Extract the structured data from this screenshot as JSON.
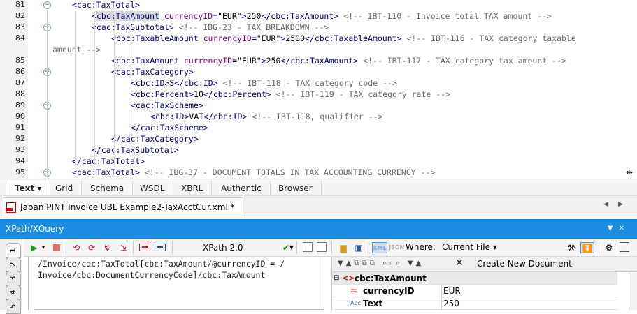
{
  "editor": {
    "lines": [
      {
        "num": "81",
        "indent": 2,
        "fold": "−",
        "parts": [
          [
            "tg",
            "<cac:TaxTotal>"
          ]
        ]
      },
      {
        "num": "82",
        "indent": 3,
        "fold": "",
        "parts": [
          [
            "tg",
            "<"
          ],
          [
            "hl",
            "cbc:TaxAmount"
          ],
          [
            "tg",
            " "
          ],
          [
            "at",
            "currencyID"
          ],
          [
            "tg",
            "="
          ],
          [
            "av",
            "\"EUR\""
          ],
          [
            "tg",
            ">"
          ],
          [
            "tx",
            "250"
          ],
          [
            "tg",
            "</cbc:TaxAmount>"
          ],
          [
            "tx",
            " "
          ],
          [
            "cm",
            "<!-- IBT-110 - Invoice total TAX amount -->"
          ]
        ]
      },
      {
        "num": "83",
        "indent": 3,
        "fold": "−",
        "parts": [
          [
            "tg",
            "<cac:TaxSubtotal>"
          ],
          [
            "tx",
            " "
          ],
          [
            "cm",
            "<!-- IBG-23 - TAX BREAKDOWN -->"
          ]
        ]
      },
      {
        "num": "84",
        "indent": 4,
        "fold": "",
        "parts": [
          [
            "tg",
            "<cbc:TaxableAmount "
          ],
          [
            "at",
            "currencyID"
          ],
          [
            "tg",
            "="
          ],
          [
            "av",
            "\"EUR\""
          ],
          [
            "tg",
            ">"
          ],
          [
            "tx",
            "2500"
          ],
          [
            "tg",
            "</cbc:TaxableAmount>"
          ],
          [
            "tx",
            " "
          ],
          [
            "cm",
            "<!-- IBT-116 - TAX category taxable"
          ]
        ]
      },
      {
        "num": "",
        "indent": 0,
        "fold": "",
        "wrap": true,
        "parts": [
          [
            "cm",
            "amount -->"
          ]
        ]
      },
      {
        "num": "85",
        "indent": 4,
        "fold": "",
        "parts": [
          [
            "tg",
            "<cbc:TaxAmount "
          ],
          [
            "at",
            "currencyID"
          ],
          [
            "tg",
            "="
          ],
          [
            "av",
            "\"EUR\""
          ],
          [
            "tg",
            ">"
          ],
          [
            "tx",
            "250"
          ],
          [
            "tg",
            "</cbc:TaxAmount>"
          ],
          [
            "tx",
            " "
          ],
          [
            "cm",
            "<!-- IBT-117 - TAX category tax amount -->"
          ]
        ]
      },
      {
        "num": "86",
        "indent": 4,
        "fold": "−",
        "parts": [
          [
            "tg",
            "<cac:TaxCategory>"
          ]
        ]
      },
      {
        "num": "87",
        "indent": 5,
        "fold": "",
        "parts": [
          [
            "tg",
            "<cbc:ID>"
          ],
          [
            "tx",
            "S"
          ],
          [
            "tg",
            "</cbc:ID>"
          ],
          [
            "tx",
            " "
          ],
          [
            "cm",
            "<!-- IBT-118 - TAX category code -->"
          ]
        ]
      },
      {
        "num": "88",
        "indent": 5,
        "fold": "",
        "parts": [
          [
            "tg",
            "<cbc:Percent>"
          ],
          [
            "tx",
            "10"
          ],
          [
            "tg",
            "</cbc:Percent>"
          ],
          [
            "tx",
            " "
          ],
          [
            "cm",
            "<!-- IBT-119 - TAX category rate -->"
          ]
        ]
      },
      {
        "num": "89",
        "indent": 5,
        "fold": "−",
        "parts": [
          [
            "tg",
            "<cac:TaxScheme>"
          ]
        ]
      },
      {
        "num": "90",
        "indent": 6,
        "fold": "",
        "parts": [
          [
            "tg",
            "<cbc:ID>"
          ],
          [
            "tx",
            "VAT"
          ],
          [
            "tg",
            "</cbc:ID>"
          ],
          [
            "tx",
            " "
          ],
          [
            "cm",
            "<!-- IBT-118, qualifier -->"
          ]
        ]
      },
      {
        "num": "91",
        "indent": 5,
        "fold": "",
        "parts": [
          [
            "tg",
            "</cac:TaxScheme>"
          ]
        ]
      },
      {
        "num": "92",
        "indent": 4,
        "fold": "",
        "parts": [
          [
            "tg",
            "</cac:TaxCategory>"
          ]
        ]
      },
      {
        "num": "93",
        "indent": 3,
        "fold": "",
        "parts": [
          [
            "tg",
            "</cac:TaxSubtotal>"
          ]
        ]
      },
      {
        "num": "94",
        "indent": 2,
        "fold": "",
        "parts": [
          [
            "tg",
            "</cac:TaxTotal>"
          ]
        ]
      },
      {
        "num": "95",
        "indent": 2,
        "fold": "−",
        "parts": [
          [
            "tg",
            "<cac:TaxTotal>"
          ],
          [
            "tx",
            " "
          ],
          [
            "cm",
            "<!-- IBG-37 - DOCUMENT TOTALS IN TAX ACCOUNTING CURRENCY -->"
          ]
        ]
      }
    ]
  },
  "view_tabs": [
    "Text ▾",
    "Grid",
    "Schema",
    "WSDL",
    "XBRL",
    "Authentic",
    "Browser"
  ],
  "document_tab": {
    "label": "Japan PINT Invoice UBL Example2-TaxAcctCur.xml *"
  },
  "xpath_panel": {
    "title": "XPath/XQuery",
    "version_combo": "XPath 2.0",
    "json_label": "JSON",
    "xml_label": "XML",
    "where_label": "Where:",
    "where_value": "Current File ▾",
    "tabs": [
      "1",
      "2",
      "3",
      "4",
      "5",
      "6"
    ],
    "expression_lines": [
      "/Invoice/cac:TaxTotal[cbc:TaxAmount/@currencyID = /",
      "Invoice/cbc:DocumentCurrencyCode]/cbc:TaxAmount"
    ],
    "results": {
      "create_label": "Create New Document",
      "rows": [
        {
          "icon": "<>",
          "name": "cbc:TaxAmount",
          "value": ""
        },
        {
          "icon": "=",
          "name": "currencyID",
          "value": "EUR"
        },
        {
          "icon": "Abc",
          "name": "Text",
          "value": "250"
        }
      ]
    }
  }
}
